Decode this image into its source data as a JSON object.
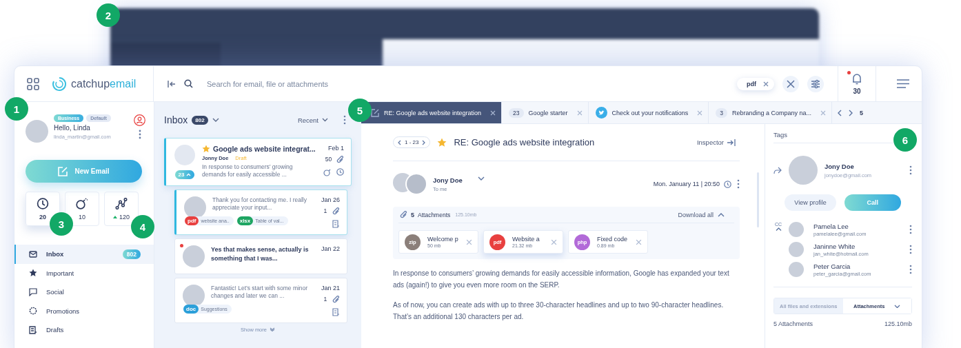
{
  "callouts": [
    "1",
    "2",
    "3",
    "4",
    "5",
    "6"
  ],
  "logo": {
    "part1": "catchup",
    "part2": "email"
  },
  "search": {
    "placeholder": "Search for email, file or attachments",
    "chip": "pdf"
  },
  "notifications": {
    "count": "30",
    "unread": true
  },
  "profile": {
    "badges": [
      {
        "label": "Business",
        "selected": true
      },
      {
        "label": "Default",
        "selected": false
      }
    ],
    "greeting": "Hello, Linda",
    "email": "linda_martin@gmail.com"
  },
  "new_email": "New Email",
  "stats": [
    {
      "kind": "clock",
      "value": "20",
      "bold": true
    },
    {
      "kind": "bomb",
      "value": "10",
      "bold": false
    },
    {
      "kind": "trend",
      "value": "120",
      "bold": false
    }
  ],
  "nav": [
    {
      "kind": "mail",
      "label": "Inbox",
      "count": "802",
      "selected": true
    },
    {
      "kind": "star",
      "label": "Important",
      "selected": false
    },
    {
      "kind": "chat",
      "label": "Social",
      "selected": false
    },
    {
      "kind": "badge",
      "label": "Promotions",
      "selected": false
    },
    {
      "kind": "draft",
      "label": "Drafts",
      "selected": false
    }
  ],
  "inbox": {
    "title": "Inbox",
    "count": "802",
    "sort": "Recent",
    "show_more": "Show more",
    "messages": [
      {
        "kind": "thread",
        "subject": "Google ads website integrat...",
        "sender": "Jonny Doe",
        "status": "Draft",
        "preview": "In response to consumers’ growing demands for easily accessible ...",
        "date": "Feb 1",
        "attachments": "50",
        "thread_count": "23",
        "selected": true,
        "unread": false
      },
      {
        "kind": "reply",
        "preview": "Thank you for contacting me. I really appreciate your input...",
        "date": "Jan 26",
        "attachments": "1",
        "files": [
          {
            "type": "pdf",
            "name": "website ana..",
            "color": "#e8403f"
          },
          {
            "type": "xlsx",
            "name": "Table of val...",
            "color": "#1ea562"
          }
        ],
        "selected": true,
        "unread": false
      },
      {
        "kind": "reply",
        "preview": "Yes that makes sense, actually is something that I was...",
        "date": "Jan 22",
        "selected": false,
        "unread": true
      },
      {
        "kind": "reply",
        "preview": "Fantastic! Let’s start with some minor changes and later we can ...",
        "date": "Jan 21",
        "attachments": "1",
        "files": [
          {
            "type": "doc",
            "name": "Suggestions",
            "color": "#2b9fd9"
          }
        ],
        "selected": false,
        "unread": false
      }
    ]
  },
  "tabs": [
    {
      "kind": "draft",
      "label": "RE: Google ads website integration",
      "selected": true
    },
    {
      "kind": "count",
      "count": "23",
      "label": "Google starter",
      "selected": false
    },
    {
      "kind": "bird",
      "label": "Check out your notifications",
      "selected": false
    },
    {
      "kind": "count",
      "count": "3",
      "label": "Rebranding a Company na...",
      "selected": false
    }
  ],
  "tab_total": "5",
  "email": {
    "range": "1 - 23",
    "subject": "RE: Google ads website integration",
    "starred": true,
    "inspector": "Inspector",
    "sender": "Jony Doe",
    "to": "To me",
    "date": "Mon. January 11  |  20:50",
    "attachments": {
      "count": "5",
      "label": "Attachments",
      "size": "125.10mb",
      "download": "Download all",
      "files": [
        {
          "type": "zip",
          "name": "Welcome p",
          "size": "50 mb",
          "color": "#8b7f7a",
          "selected": false
        },
        {
          "type": "pdf",
          "name": "Website a",
          "size": "21.32 mb",
          "color": "#e8403f",
          "selected": true
        },
        {
          "type": "php",
          "name": "Fixed code",
          "size": "0.89 mb",
          "color": "#b26ad8",
          "selected": false
        }
      ]
    },
    "body": [
      "In response to consumers’ growing demands for easily accessible information, Google has expanded your text ads (again!) to give you even more room on the SERP.",
      "As of now, you can create ads with up to three 30-character headlines and up to two 90-character headlines. That’s an additional 130 characters per ad."
    ]
  },
  "inspector": {
    "tags": "Tags",
    "contact": {
      "name": "Jony Doe",
      "email": "jonydoe@gmail.com"
    },
    "view_profile": "View profile",
    "call": "Call",
    "cc_label": "CC",
    "cc": [
      {
        "name": "Pamela Lee",
        "email": "pamelalee@gmail.com"
      },
      {
        "name": "Janinne White",
        "email": "jan_white@hotmail.com"
      },
      {
        "name": "Peter Garcia",
        "email": "peter_garcia@gmail.com"
      }
    ],
    "file_tabs": [
      {
        "label": "All files and extensions",
        "selected": false
      },
      {
        "label": "Attachments",
        "selected": true
      }
    ],
    "summary": "5 Attachments",
    "summary_size": "125.10mb"
  }
}
